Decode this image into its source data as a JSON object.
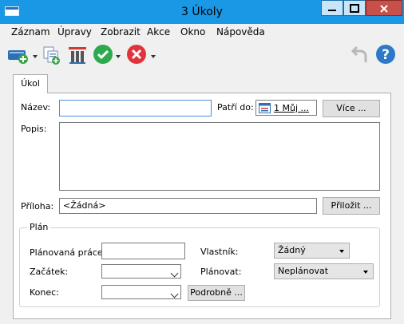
{
  "window": {
    "title": "3 Úkoly"
  },
  "menu": [
    "Záznam",
    "Úpravy",
    "Zobrazit",
    "Akce",
    "Okno",
    "Nápověda"
  ],
  "toolbar": {
    "icons": [
      "new-record-icon",
      "copy-icon",
      "delete-icon",
      "complete-check-icon",
      "cancel-icon",
      "undo-icon",
      "help-icon"
    ],
    "colors": {
      "check": "#2eaa4e",
      "cancel": "#e0343c",
      "help": "#2d79c7",
      "new": "#2f6fb6"
    }
  },
  "tab": {
    "label": "Úkol"
  },
  "form": {
    "name_label": "Název:",
    "name_value": "",
    "belongs_label": "Patří do:",
    "belongs_value": "1 Můj ...",
    "more_button": "Více ...",
    "desc_label": "Popis:",
    "desc_value": "",
    "attach_label": "Příloha:",
    "attach_value": "<Žádná>",
    "attach_button": "Přiložit ..."
  },
  "plan": {
    "title": "Plán",
    "planned_work_label": "Plánovaná práce:",
    "planned_work_value": "",
    "start_label": "Začátek:",
    "start_value": "",
    "end_label": "Konec:",
    "end_value": "",
    "details_button": "Podrobně ...",
    "owner_label": "Vlastník:",
    "owner_value": "Žádný",
    "schedule_label": "Plánovat:",
    "schedule_value": "Neplánovat"
  }
}
